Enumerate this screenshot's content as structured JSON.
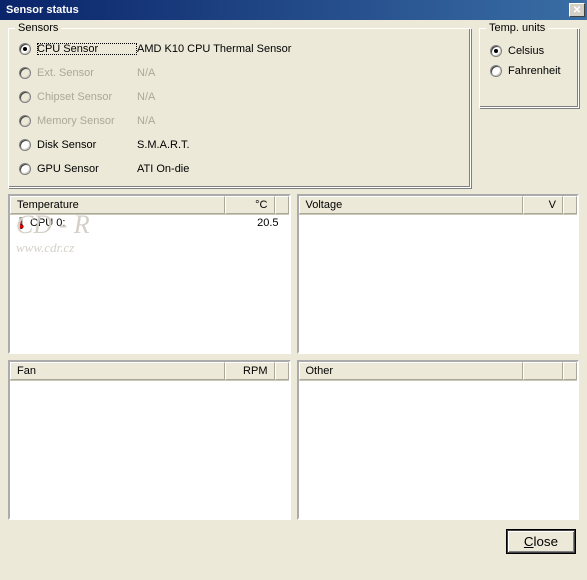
{
  "title": "Sensor status",
  "sensorsLegend": "Sensors",
  "tempLegend": "Temp. units",
  "sensors": [
    {
      "label": "CPU Sensor",
      "value": "AMD K10 CPU Thermal Sensor",
      "enabled": true,
      "checked": true,
      "selected": true
    },
    {
      "label": "Ext. Sensor",
      "value": "N/A",
      "enabled": false,
      "checked": false
    },
    {
      "label": "Chipset Sensor",
      "value": "N/A",
      "enabled": false,
      "checked": false
    },
    {
      "label": "Memory Sensor",
      "value": "N/A",
      "enabled": false,
      "checked": false
    },
    {
      "label": "Disk Sensor",
      "value": "S.M.A.R.T.",
      "enabled": true,
      "checked": false
    },
    {
      "label": "GPU Sensor",
      "value": "ATI On-die",
      "enabled": true,
      "checked": false
    }
  ],
  "tempUnits": [
    {
      "label": "Celsius",
      "checked": true
    },
    {
      "label": "Fahrenheit",
      "checked": false
    }
  ],
  "panels": {
    "temperature": {
      "header": "Temperature",
      "unit": "°C",
      "rows": [
        {
          "label": "CPU 0:",
          "value": "20.5"
        }
      ]
    },
    "voltage": {
      "header": "Voltage",
      "unit": "V",
      "rows": []
    },
    "fan": {
      "header": "Fan",
      "unit": "RPM",
      "rows": []
    },
    "other": {
      "header": "Other",
      "unit": "",
      "rows": []
    }
  },
  "closeLabelPrefix": "C",
  "closeLabelSuffix": "lose",
  "watermarkBig": "CD - R",
  "watermarkSmall": "www.cdr.cz"
}
